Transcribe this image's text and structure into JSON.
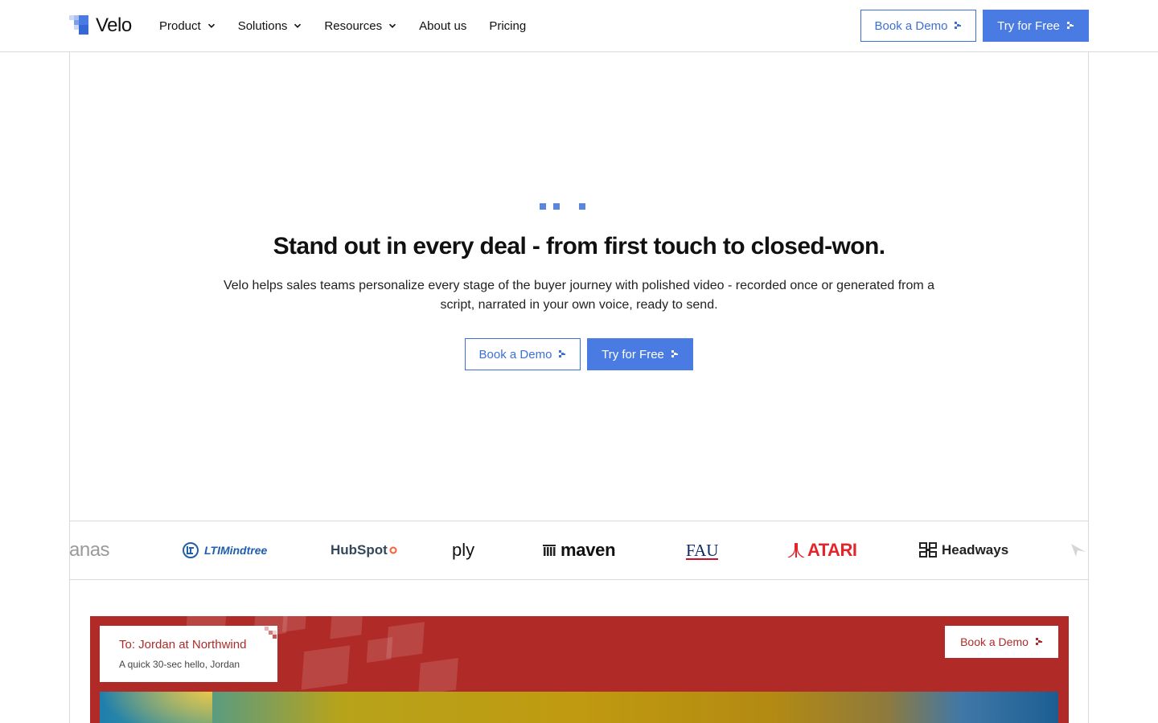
{
  "header": {
    "brand": "Velo",
    "nav": [
      {
        "label": "Product",
        "has_menu": true
      },
      {
        "label": "Solutions",
        "has_menu": true
      },
      {
        "label": "Resources",
        "has_menu": true
      },
      {
        "label": "About us",
        "has_menu": false
      },
      {
        "label": "Pricing",
        "has_menu": false
      }
    ],
    "book_demo": "Book a Demo",
    "try_free": "Try for Free"
  },
  "hero": {
    "title": "Stand out in every deal - from first touch to closed-won.",
    "subtitle": "Velo helps sales teams personalize every stage of the buyer journey with polished video - recorded once or generated from a script, narrated in your own voice, ready to send.",
    "book_demo": "Book a Demo",
    "try_free": "Try for Free"
  },
  "logos": [
    {
      "name": "anas",
      "icon": "partial-wordmark"
    },
    {
      "name": "LTIMindtree",
      "icon": "ltimindtree-logo"
    },
    {
      "name": "HubSpot",
      "icon": "hubspot-logo"
    },
    {
      "name": "ply",
      "icon": "ply-logo"
    },
    {
      "name": "maven",
      "icon": "maven-logo"
    },
    {
      "name": "FAU",
      "icon": "fau-logo"
    },
    {
      "name": "ATARI",
      "icon": "atari-logo"
    },
    {
      "name": "Headways",
      "icon": "headways-logo"
    }
  ],
  "demo_card": {
    "to_line": "To: Jordan at Northwind",
    "subline": "A quick 30-sec hello, Jordan",
    "book_demo": "Book a Demo"
  },
  "colors": {
    "accent": "#4a7be3",
    "accent_text": "#3c6fd8",
    "demo_bg": "#b02b28",
    "border": "#d9d9d9"
  }
}
